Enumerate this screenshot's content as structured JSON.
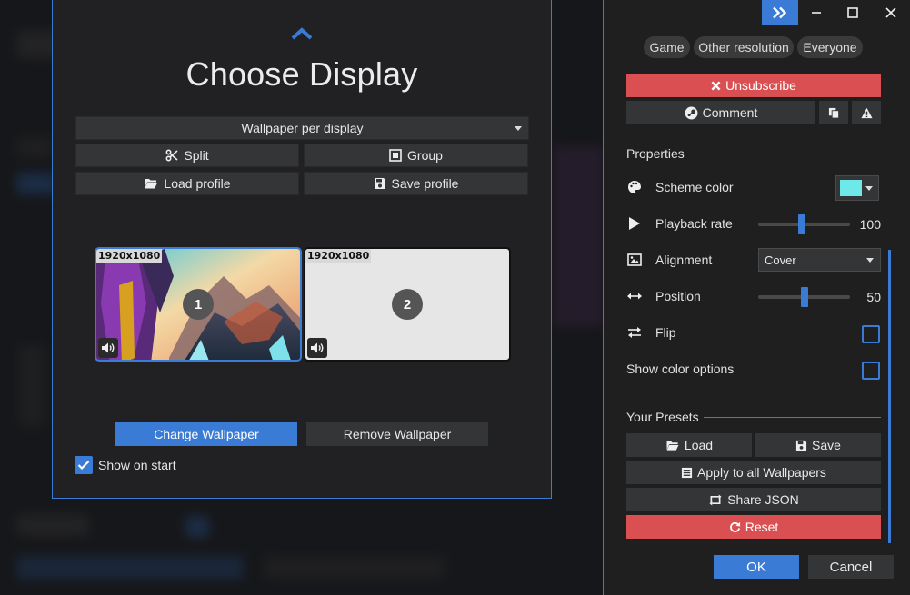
{
  "modal": {
    "title": "Choose Display",
    "mode_select": "Wallpaper per display",
    "split_label": "Split",
    "group_label": "Group",
    "load_profile_label": "Load profile",
    "save_profile_label": "Save profile",
    "displays": [
      {
        "resolution": "1920x1080",
        "number": "1"
      },
      {
        "resolution": "1920x1080",
        "number": "2"
      }
    ],
    "change_wallpaper_label": "Change Wallpaper",
    "remove_wallpaper_label": "Remove Wallpaper",
    "show_on_start_label": "Show on start",
    "show_on_start_checked": true
  },
  "panel": {
    "tags": [
      "Game",
      "Other resolution",
      "Everyone"
    ],
    "unsubscribe_label": "Unsubscribe",
    "comment_label": "Comment",
    "properties_heading": "Properties",
    "scheme_color_label": "Scheme color",
    "scheme_color_value": "#6ee8e8",
    "playback_rate_label": "Playback rate",
    "playback_rate_value": "100",
    "alignment_label": "Alignment",
    "alignment_value": "Cover",
    "position_label": "Position",
    "position_value": "50",
    "flip_label": "Flip",
    "show_color_options_label": "Show color options",
    "presets_heading": "Your Presets",
    "load_label": "Load",
    "save_label": "Save",
    "apply_all_label": "Apply to all Wallpapers",
    "share_json_label": "Share JSON",
    "reset_label": "Reset",
    "ok_label": "OK",
    "cancel_label": "Cancel"
  },
  "colors": {
    "accent": "#3a7bd5",
    "danger": "#d94f52"
  }
}
